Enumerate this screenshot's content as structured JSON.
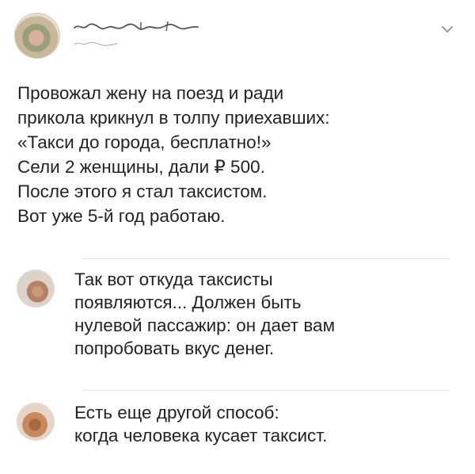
{
  "post": {
    "text": "Провожал жену на поезд и ради\nприкола крикнул в толпу приехавших:\n«Такси до города, бесплатно!»\nСели 2 женщины, дали ₽ 500.\nПосле этого я стал таксистом.\nВот уже 5-й год работаю."
  },
  "replies": [
    {
      "text": "Так вот откуда таксисты\nпоявляются... Должен быть\nнулевой пассажир: он дает вам\nпопробовать вкус денег."
    },
    {
      "text": "Есть еще другой способ:\nкогда человека кусает таксист."
    }
  ],
  "icons": {
    "menu": "chevron-down-icon"
  }
}
